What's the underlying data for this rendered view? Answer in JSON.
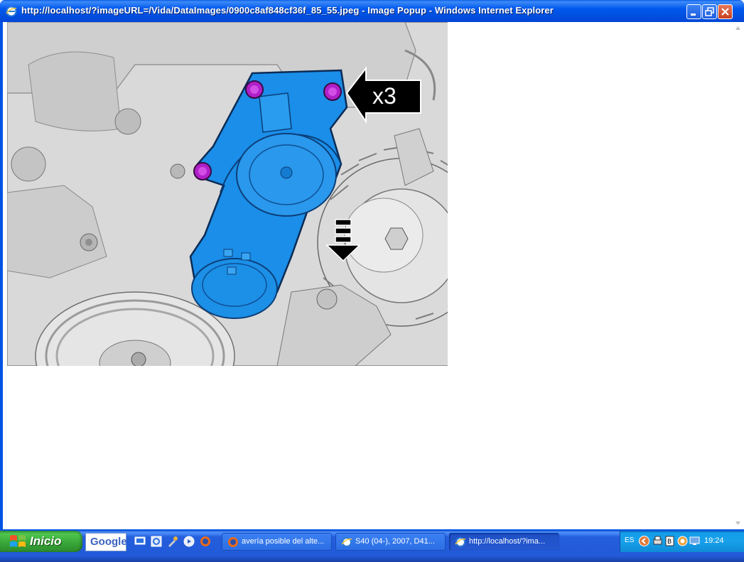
{
  "window": {
    "title": "http://localhost/?imageURL=/Vida/DataImages/0900c8af848cf36f_85_55.jpeg - Image Popup - Windows Internet Explorer",
    "icon": "ie-icon"
  },
  "illustration": {
    "callout_label": "x3",
    "colors": {
      "component": "#1a8ee8",
      "bolts": "#b020c8",
      "engine": "#d8d8d8"
    }
  },
  "taskbar": {
    "start_label": "Inicio",
    "google_label": "Google",
    "quick_launch": [
      "desktop-icon",
      "explorer-icon",
      "tools-icon",
      "media-icon",
      "firefox-icon"
    ],
    "tasks": [
      {
        "label": "avería posible del alte...",
        "icon": "firefox-icon"
      },
      {
        "label": "S40 (04-), 2007, D41...",
        "icon": "ie-icon"
      },
      {
        "label": "http://localhost/?ima...",
        "icon": "ie-icon"
      }
    ],
    "tray": {
      "language": "ES",
      "time": "19:24"
    }
  }
}
